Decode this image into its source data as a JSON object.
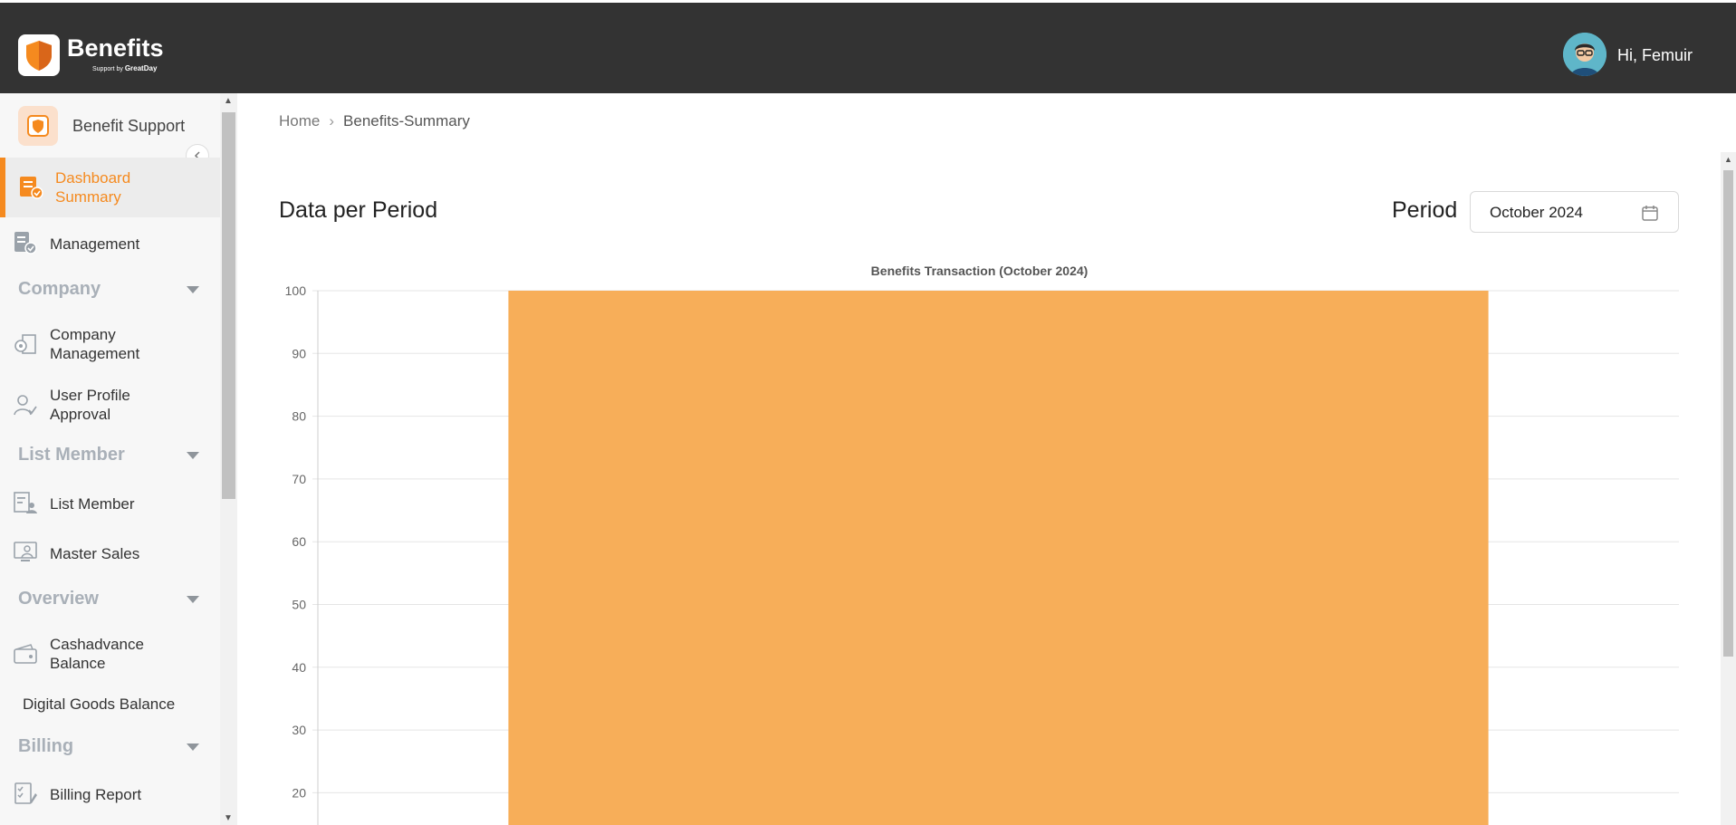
{
  "header": {
    "app_title": "Benefits",
    "app_subtitle": "Support by",
    "app_subtitle_brand": "GreatDay",
    "greeting": "Hi, Femuir"
  },
  "sidebar": {
    "brand_label": "Benefit Support",
    "items": [
      {
        "label": "Dashboard Summary",
        "icon": "dashboard-icon",
        "active": true
      },
      {
        "label": "Management",
        "icon": "management-icon"
      },
      {
        "section": "Company"
      },
      {
        "label": "Company Management",
        "icon": "company-settings-icon"
      },
      {
        "label": "User Profile Approval",
        "icon": "user-approval-icon"
      },
      {
        "section": "List Member"
      },
      {
        "label": "List Member",
        "icon": "member-list-icon"
      },
      {
        "label": "Master Sales",
        "icon": "master-sales-icon"
      },
      {
        "section": "Overview"
      },
      {
        "label": "Cashadvance Balance",
        "icon": "wallet-icon"
      },
      {
        "label": "Digital Goods Balance"
      },
      {
        "section": "Billing"
      },
      {
        "label": "Billing Report",
        "icon": "billing-report-icon"
      }
    ]
  },
  "breadcrumb": {
    "home": "Home",
    "current": "Benefits-Summary"
  },
  "main": {
    "section_title": "Data per Period",
    "period_label": "Period",
    "period_value": "October 2024"
  },
  "colors": {
    "accent": "#f58a1f",
    "bar": "#f7ae59",
    "topbar": "#333333"
  },
  "chart_data": {
    "type": "bar",
    "title": "Benefits Transaction (October 2024)",
    "categories": [
      ""
    ],
    "values": [
      100
    ],
    "ylim": [
      20,
      100
    ],
    "yticks": [
      20,
      30,
      40,
      50,
      60,
      70,
      80,
      90,
      100
    ],
    "grid": true
  }
}
